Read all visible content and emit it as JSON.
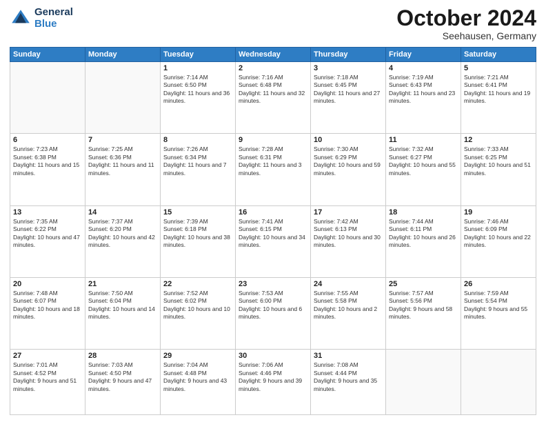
{
  "header": {
    "logo_general": "General",
    "logo_blue": "Blue",
    "month": "October 2024",
    "location": "Seehausen, Germany"
  },
  "days_of_week": [
    "Sunday",
    "Monday",
    "Tuesday",
    "Wednesday",
    "Thursday",
    "Friday",
    "Saturday"
  ],
  "weeks": [
    [
      {
        "day": "",
        "info": ""
      },
      {
        "day": "",
        "info": ""
      },
      {
        "day": "1",
        "info": "Sunrise: 7:14 AM\nSunset: 6:50 PM\nDaylight: 11 hours and 36 minutes."
      },
      {
        "day": "2",
        "info": "Sunrise: 7:16 AM\nSunset: 6:48 PM\nDaylight: 11 hours and 32 minutes."
      },
      {
        "day": "3",
        "info": "Sunrise: 7:18 AM\nSunset: 6:45 PM\nDaylight: 11 hours and 27 minutes."
      },
      {
        "day": "4",
        "info": "Sunrise: 7:19 AM\nSunset: 6:43 PM\nDaylight: 11 hours and 23 minutes."
      },
      {
        "day": "5",
        "info": "Sunrise: 7:21 AM\nSunset: 6:41 PM\nDaylight: 11 hours and 19 minutes."
      }
    ],
    [
      {
        "day": "6",
        "info": "Sunrise: 7:23 AM\nSunset: 6:38 PM\nDaylight: 11 hours and 15 minutes."
      },
      {
        "day": "7",
        "info": "Sunrise: 7:25 AM\nSunset: 6:36 PM\nDaylight: 11 hours and 11 minutes."
      },
      {
        "day": "8",
        "info": "Sunrise: 7:26 AM\nSunset: 6:34 PM\nDaylight: 11 hours and 7 minutes."
      },
      {
        "day": "9",
        "info": "Sunrise: 7:28 AM\nSunset: 6:31 PM\nDaylight: 11 hours and 3 minutes."
      },
      {
        "day": "10",
        "info": "Sunrise: 7:30 AM\nSunset: 6:29 PM\nDaylight: 10 hours and 59 minutes."
      },
      {
        "day": "11",
        "info": "Sunrise: 7:32 AM\nSunset: 6:27 PM\nDaylight: 10 hours and 55 minutes."
      },
      {
        "day": "12",
        "info": "Sunrise: 7:33 AM\nSunset: 6:25 PM\nDaylight: 10 hours and 51 minutes."
      }
    ],
    [
      {
        "day": "13",
        "info": "Sunrise: 7:35 AM\nSunset: 6:22 PM\nDaylight: 10 hours and 47 minutes."
      },
      {
        "day": "14",
        "info": "Sunrise: 7:37 AM\nSunset: 6:20 PM\nDaylight: 10 hours and 42 minutes."
      },
      {
        "day": "15",
        "info": "Sunrise: 7:39 AM\nSunset: 6:18 PM\nDaylight: 10 hours and 38 minutes."
      },
      {
        "day": "16",
        "info": "Sunrise: 7:41 AM\nSunset: 6:15 PM\nDaylight: 10 hours and 34 minutes."
      },
      {
        "day": "17",
        "info": "Sunrise: 7:42 AM\nSunset: 6:13 PM\nDaylight: 10 hours and 30 minutes."
      },
      {
        "day": "18",
        "info": "Sunrise: 7:44 AM\nSunset: 6:11 PM\nDaylight: 10 hours and 26 minutes."
      },
      {
        "day": "19",
        "info": "Sunrise: 7:46 AM\nSunset: 6:09 PM\nDaylight: 10 hours and 22 minutes."
      }
    ],
    [
      {
        "day": "20",
        "info": "Sunrise: 7:48 AM\nSunset: 6:07 PM\nDaylight: 10 hours and 18 minutes."
      },
      {
        "day": "21",
        "info": "Sunrise: 7:50 AM\nSunset: 6:04 PM\nDaylight: 10 hours and 14 minutes."
      },
      {
        "day": "22",
        "info": "Sunrise: 7:52 AM\nSunset: 6:02 PM\nDaylight: 10 hours and 10 minutes."
      },
      {
        "day": "23",
        "info": "Sunrise: 7:53 AM\nSunset: 6:00 PM\nDaylight: 10 hours and 6 minutes."
      },
      {
        "day": "24",
        "info": "Sunrise: 7:55 AM\nSunset: 5:58 PM\nDaylight: 10 hours and 2 minutes."
      },
      {
        "day": "25",
        "info": "Sunrise: 7:57 AM\nSunset: 5:56 PM\nDaylight: 9 hours and 58 minutes."
      },
      {
        "day": "26",
        "info": "Sunrise: 7:59 AM\nSunset: 5:54 PM\nDaylight: 9 hours and 55 minutes."
      }
    ],
    [
      {
        "day": "27",
        "info": "Sunrise: 7:01 AM\nSunset: 4:52 PM\nDaylight: 9 hours and 51 minutes."
      },
      {
        "day": "28",
        "info": "Sunrise: 7:03 AM\nSunset: 4:50 PM\nDaylight: 9 hours and 47 minutes."
      },
      {
        "day": "29",
        "info": "Sunrise: 7:04 AM\nSunset: 4:48 PM\nDaylight: 9 hours and 43 minutes."
      },
      {
        "day": "30",
        "info": "Sunrise: 7:06 AM\nSunset: 4:46 PM\nDaylight: 9 hours and 39 minutes."
      },
      {
        "day": "31",
        "info": "Sunrise: 7:08 AM\nSunset: 4:44 PM\nDaylight: 9 hours and 35 minutes."
      },
      {
        "day": "",
        "info": ""
      },
      {
        "day": "",
        "info": ""
      }
    ]
  ]
}
